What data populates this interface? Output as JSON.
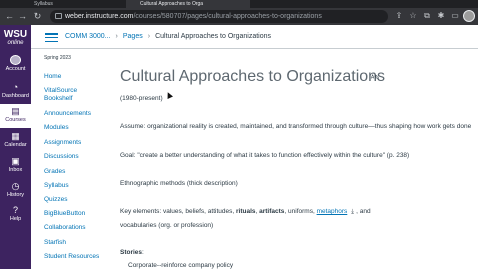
{
  "browser": {
    "tabs": [
      "Syllabus",
      "Cultural Approaches to Orga"
    ],
    "url_host": "weber.instructure.com",
    "url_path": "/courses/580707/pages/cultural-approaches-to-organizations"
  },
  "global_nav": {
    "logo_line1": "WSU",
    "logo_line2": "online",
    "items": [
      {
        "label": "Account",
        "icon": "account-icon"
      },
      {
        "label": "Dashboard",
        "icon": "dashboard-icon"
      },
      {
        "label": "Courses",
        "icon": "courses-icon"
      },
      {
        "label": "Calendar",
        "icon": "calendar-icon"
      },
      {
        "label": "Inbox",
        "icon": "inbox-icon"
      },
      {
        "label": "History",
        "icon": "history-icon"
      },
      {
        "label": "Help",
        "icon": "help-icon"
      }
    ]
  },
  "breadcrumb": {
    "course": "COMM 3000...",
    "section": "Pages",
    "current": "Cultural Approaches to Organizations"
  },
  "course_nav": {
    "term": "Spring 2023",
    "items": [
      "Home",
      "VitalSource",
      "Bookshelf",
      "Announcements",
      "Modules",
      "Assignments",
      "Discussions",
      "Grades",
      "Syllabus",
      "Quizzes",
      "BigBlueButton",
      "Collaborations",
      "Starfish",
      "Student Resources"
    ]
  },
  "page": {
    "title": "Cultural Approaches to Organizations",
    "p1": "(1980-present)",
    "p2": "Assume: organizational reality is created, maintained, and transformed through culture—thus shaping how work gets done",
    "p3": "Goal: \"create a better understanding of what it takes to function effectively within the culture\" (p. 238)",
    "p4": "Ethnographic methods (thick description)",
    "p5_a": "Key elements: values, beliefs, attitudes, ",
    "p5_b": "rituals",
    "p5_c": ", ",
    "p5_d": "artifacts",
    "p5_e": ", uniforms, ",
    "p5_link": "metaphors",
    "p5_f": ", and",
    "p6": "vocabularies (org. or profession)",
    "p7": "Stories",
    "p7_colon": ":",
    "p8": "Corporate--reinforce company policy"
  },
  "colors": {
    "nav_bg": "#3d2360",
    "link": "#0374b5",
    "text": "#2d3b45"
  }
}
